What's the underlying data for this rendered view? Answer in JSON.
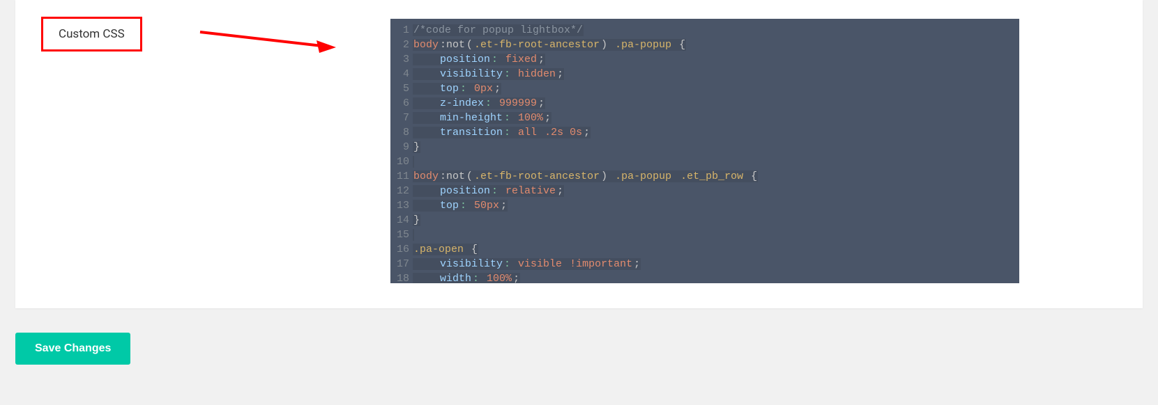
{
  "label": "Custom CSS",
  "save_label": "Save Changes",
  "code": {
    "lines": [
      {
        "n": "1",
        "tokens": [
          {
            "c": "comment",
            "t": "/*code for popup lightbox*/"
          }
        ]
      },
      {
        "n": "2",
        "tokens": [
          {
            "c": "tag",
            "t": "body"
          },
          {
            "c": "pseudo",
            "t": ":not"
          },
          {
            "c": "plain",
            "t": "("
          },
          {
            "c": "class",
            "t": ".et-fb-root-ancestor"
          },
          {
            "c": "plain",
            "t": ") "
          },
          {
            "c": "class",
            "t": ".pa-popup"
          },
          {
            "c": "plain",
            "t": " {"
          }
        ]
      },
      {
        "n": "3",
        "tokens": [
          {
            "c": "plain",
            "t": "    "
          },
          {
            "c": "prop",
            "t": "position"
          },
          {
            "c": "punct",
            "t": ": "
          },
          {
            "c": "val",
            "t": "fixed"
          },
          {
            "c": "plain",
            "t": ";"
          }
        ]
      },
      {
        "n": "4",
        "tokens": [
          {
            "c": "plain",
            "t": "    "
          },
          {
            "c": "prop",
            "t": "visibility"
          },
          {
            "c": "punct",
            "t": ": "
          },
          {
            "c": "val",
            "t": "hidden"
          },
          {
            "c": "plain",
            "t": ";"
          }
        ]
      },
      {
        "n": "5",
        "tokens": [
          {
            "c": "plain",
            "t": "    "
          },
          {
            "c": "prop",
            "t": "top"
          },
          {
            "c": "punct",
            "t": ": "
          },
          {
            "c": "num",
            "t": "0px"
          },
          {
            "c": "plain",
            "t": ";"
          }
        ]
      },
      {
        "n": "6",
        "tokens": [
          {
            "c": "plain",
            "t": "    "
          },
          {
            "c": "prop",
            "t": "z-index"
          },
          {
            "c": "punct",
            "t": ": "
          },
          {
            "c": "num",
            "t": "999999"
          },
          {
            "c": "plain",
            "t": ";"
          }
        ]
      },
      {
        "n": "7",
        "tokens": [
          {
            "c": "plain",
            "t": "    "
          },
          {
            "c": "prop",
            "t": "min-height"
          },
          {
            "c": "punct",
            "t": ": "
          },
          {
            "c": "num",
            "t": "100%"
          },
          {
            "c": "plain",
            "t": ";"
          }
        ]
      },
      {
        "n": "8",
        "tokens": [
          {
            "c": "plain",
            "t": "    "
          },
          {
            "c": "prop",
            "t": "transition"
          },
          {
            "c": "punct",
            "t": ": "
          },
          {
            "c": "val",
            "t": "all "
          },
          {
            "c": "num",
            "t": ".2s 0s"
          },
          {
            "c": "plain",
            "t": ";"
          }
        ]
      },
      {
        "n": "9",
        "tokens": [
          {
            "c": "plain",
            "t": "}"
          }
        ]
      },
      {
        "n": "10",
        "tokens": [
          {
            "c": "plain",
            "t": ""
          }
        ]
      },
      {
        "n": "11",
        "tokens": [
          {
            "c": "tag",
            "t": "body"
          },
          {
            "c": "pseudo",
            "t": ":not"
          },
          {
            "c": "plain",
            "t": "("
          },
          {
            "c": "class",
            "t": ".et-fb-root-ancestor"
          },
          {
            "c": "plain",
            "t": ") "
          },
          {
            "c": "class",
            "t": ".pa-popup"
          },
          {
            "c": "plain",
            "t": " "
          },
          {
            "c": "class",
            "t": ".et_pb_row"
          },
          {
            "c": "plain",
            "t": " {"
          }
        ]
      },
      {
        "n": "12",
        "tokens": [
          {
            "c": "plain",
            "t": "    "
          },
          {
            "c": "prop",
            "t": "position"
          },
          {
            "c": "punct",
            "t": ": "
          },
          {
            "c": "val",
            "t": "relative"
          },
          {
            "c": "plain",
            "t": ";"
          }
        ]
      },
      {
        "n": "13",
        "tokens": [
          {
            "c": "plain",
            "t": "    "
          },
          {
            "c": "prop",
            "t": "top"
          },
          {
            "c": "punct",
            "t": ": "
          },
          {
            "c": "num",
            "t": "50px"
          },
          {
            "c": "plain",
            "t": ";"
          }
        ]
      },
      {
        "n": "14",
        "tokens": [
          {
            "c": "plain",
            "t": "}"
          }
        ]
      },
      {
        "n": "15",
        "tokens": [
          {
            "c": "plain",
            "t": ""
          }
        ]
      },
      {
        "n": "16",
        "tokens": [
          {
            "c": "class",
            "t": ".pa-open"
          },
          {
            "c": "plain",
            "t": " {"
          }
        ]
      },
      {
        "n": "17",
        "tokens": [
          {
            "c": "plain",
            "t": "    "
          },
          {
            "c": "prop",
            "t": "visibility"
          },
          {
            "c": "punct",
            "t": ": "
          },
          {
            "c": "val",
            "t": "visible "
          },
          {
            "c": "kw",
            "t": "!important"
          },
          {
            "c": "plain",
            "t": ";"
          }
        ]
      },
      {
        "n": "18",
        "tokens": [
          {
            "c": "plain",
            "t": "    "
          },
          {
            "c": "prop",
            "t": "width"
          },
          {
            "c": "punct",
            "t": ": "
          },
          {
            "c": "num",
            "t": "100%"
          },
          {
            "c": "plain",
            "t": ";"
          }
        ]
      }
    ]
  }
}
